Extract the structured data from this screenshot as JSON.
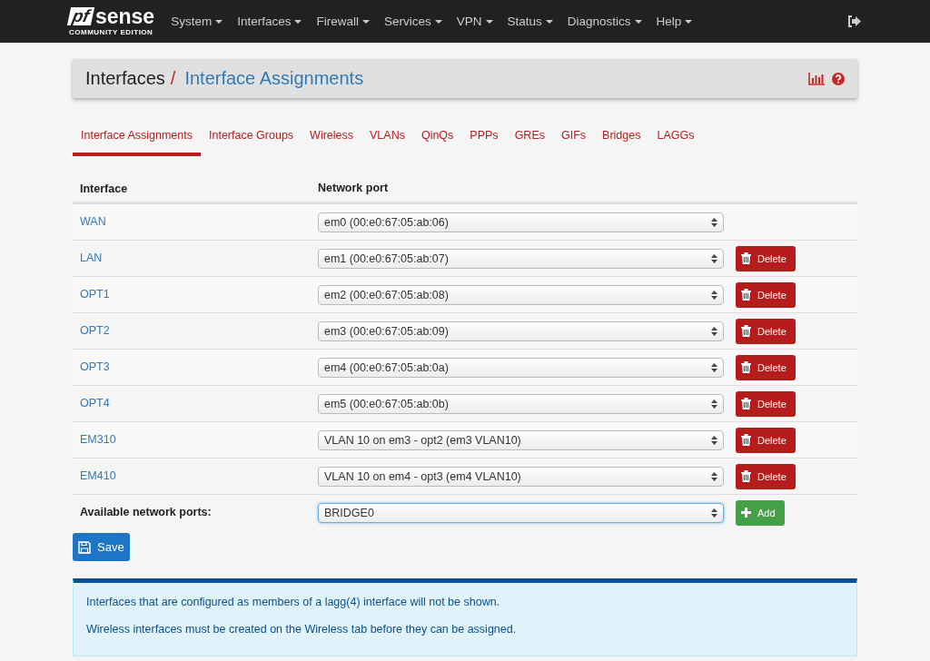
{
  "navbar": {
    "logo": {
      "brand_a": "pf",
      "brand_b": "sense",
      "edition": "COMMUNITY EDITION"
    },
    "menu": [
      {
        "label": "System",
        "dropdown": true
      },
      {
        "label": "Interfaces",
        "dropdown": true
      },
      {
        "label": "Firewall",
        "dropdown": true
      },
      {
        "label": "Services",
        "dropdown": true
      },
      {
        "label": "VPN",
        "dropdown": true
      },
      {
        "label": "Status",
        "dropdown": true
      },
      {
        "label": "Diagnostics",
        "dropdown": true
      },
      {
        "label": "Help",
        "dropdown": true
      }
    ]
  },
  "breadcrumb": {
    "parent": "Interfaces",
    "separator": "/",
    "current": "Interface Assignments"
  },
  "tabs": [
    {
      "label": "Interface Assignments",
      "selected": true
    },
    {
      "label": "Interface Groups",
      "selected": false
    },
    {
      "label": "Wireless",
      "selected": false
    },
    {
      "label": "VLANs",
      "selected": false
    },
    {
      "label": "QinQs",
      "selected": false
    },
    {
      "label": "PPPs",
      "selected": false
    },
    {
      "label": "GREs",
      "selected": false
    },
    {
      "label": "GIFs",
      "selected": false
    },
    {
      "label": "Bridges",
      "selected": false
    },
    {
      "label": "LAGGs",
      "selected": false
    }
  ],
  "table": {
    "columns": [
      "Interface",
      "Network port"
    ],
    "rows": [
      {
        "interface": "WAN",
        "port": "em0 (00:e0:67:05:ab:06)"
      },
      {
        "interface": "LAN",
        "port": "em1 (00:e0:67:05:ab:07)",
        "delete_label": "Delete"
      },
      {
        "interface": "OPT1",
        "port": "em2 (00:e0:67:05:ab:08)",
        "delete_label": "Delete"
      },
      {
        "interface": "OPT2",
        "port": "em3 (00:e0:67:05:ab:09)",
        "delete_label": "Delete"
      },
      {
        "interface": "OPT3",
        "port": "em4 (00:e0:67:05:ab:0a)",
        "delete_label": "Delete"
      },
      {
        "interface": "OPT4",
        "port": "em5 (00:e0:67:05:ab:0b)",
        "delete_label": "Delete"
      },
      {
        "interface": "EM310",
        "port": "VLAN 10 on em3 - opt2 (em3 VLAN10)",
        "delete_label": "Delete"
      },
      {
        "interface": "EM410",
        "port": "VLAN 10 on em4 - opt3 (em4 VLAN10)",
        "delete_label": "Delete"
      }
    ],
    "available": {
      "label": "Available network ports:",
      "port": "BRIDGE0",
      "focused": true,
      "add_label": "Add"
    }
  },
  "save_label": "Save",
  "info": [
    "Interfaces that are configured as members of a lagg(4) interface will not be shown.",
    "Wireless interfaces must be created on the Wireless tab before they can be assigned."
  ]
}
